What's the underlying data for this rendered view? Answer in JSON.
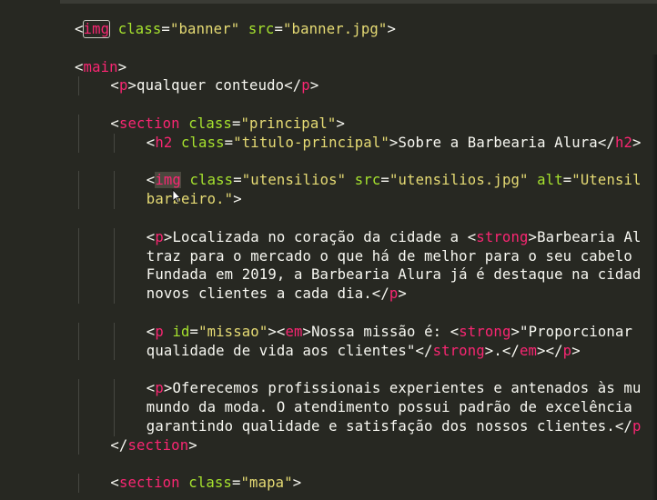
{
  "editor": {
    "theme": "monokai",
    "colors": {
      "background": "#272822",
      "tag": "#f92672",
      "attribute": "#a6e22e",
      "string": "#e6db74",
      "text": "#f8f8f2"
    },
    "lines": [
      {
        "indent": 0,
        "tokens": [
          {
            "t": "<",
            "c": "punct"
          },
          {
            "t": "img",
            "c": "tag",
            "boxed": true
          },
          {
            "t": " ",
            "c": "txt"
          },
          {
            "t": "class",
            "c": "attr"
          },
          {
            "t": "=",
            "c": "punct"
          },
          {
            "t": "\"banner\"",
            "c": "str"
          },
          {
            "t": " ",
            "c": "txt"
          },
          {
            "t": "src",
            "c": "attr"
          },
          {
            "t": "=",
            "c": "punct"
          },
          {
            "t": "\"banner.jpg\"",
            "c": "str"
          },
          {
            "t": ">",
            "c": "punct"
          }
        ]
      },
      {
        "indent": 0,
        "tokens": []
      },
      {
        "indent": 0,
        "tokens": [
          {
            "t": "<",
            "c": "punct"
          },
          {
            "t": "main",
            "c": "tag"
          },
          {
            "t": ">",
            "c": "punct"
          }
        ]
      },
      {
        "indent": 1,
        "tokens": [
          {
            "t": "<",
            "c": "punct"
          },
          {
            "t": "p",
            "c": "tag"
          },
          {
            "t": ">",
            "c": "punct"
          },
          {
            "t": "qualquer conteudo",
            "c": "txt"
          },
          {
            "t": "</",
            "c": "punct"
          },
          {
            "t": "p",
            "c": "tag"
          },
          {
            "t": ">",
            "c": "punct"
          }
        ]
      },
      {
        "indent": 0,
        "tokens": []
      },
      {
        "indent": 1,
        "tokens": [
          {
            "t": "<",
            "c": "punct"
          },
          {
            "t": "section",
            "c": "tag"
          },
          {
            "t": " ",
            "c": "txt"
          },
          {
            "t": "class",
            "c": "attr"
          },
          {
            "t": "=",
            "c": "punct"
          },
          {
            "t": "\"principal\"",
            "c": "str"
          },
          {
            "t": ">",
            "c": "punct"
          }
        ]
      },
      {
        "indent": 2,
        "tokens": [
          {
            "t": "<",
            "c": "punct"
          },
          {
            "t": "h2",
            "c": "tag"
          },
          {
            "t": " ",
            "c": "txt"
          },
          {
            "t": "class",
            "c": "attr"
          },
          {
            "t": "=",
            "c": "punct"
          },
          {
            "t": "\"titulo-principal\"",
            "c": "str"
          },
          {
            "t": ">",
            "c": "punct"
          },
          {
            "t": "Sobre a Barbearia Alura",
            "c": "txt"
          },
          {
            "t": "</",
            "c": "punct"
          },
          {
            "t": "h2",
            "c": "tag"
          },
          {
            "t": ">",
            "c": "punct"
          }
        ]
      },
      {
        "indent": 0,
        "tokens": []
      },
      {
        "indent": 2,
        "tokens": [
          {
            "t": "<",
            "c": "punct"
          },
          {
            "t": "img",
            "c": "tag",
            "hl": true
          },
          {
            "t": " ",
            "c": "txt"
          },
          {
            "t": "class",
            "c": "attr"
          },
          {
            "t": "=",
            "c": "punct"
          },
          {
            "t": "\"utensilios\"",
            "c": "str"
          },
          {
            "t": " ",
            "c": "txt"
          },
          {
            "t": "src",
            "c": "attr"
          },
          {
            "t": "=",
            "c": "punct"
          },
          {
            "t": "\"utensilios.jpg\"",
            "c": "str"
          },
          {
            "t": " ",
            "c": "txt"
          },
          {
            "t": "alt",
            "c": "attr"
          },
          {
            "t": "=",
            "c": "punct"
          },
          {
            "t": "\"Utensil",
            "c": "str"
          }
        ]
      },
      {
        "indent": 2,
        "tokens": [
          {
            "t": "barbeiro.\"",
            "c": "str"
          },
          {
            "t": ">",
            "c": "punct"
          }
        ]
      },
      {
        "indent": 0,
        "tokens": []
      },
      {
        "indent": 2,
        "tokens": [
          {
            "t": "<",
            "c": "punct"
          },
          {
            "t": "p",
            "c": "tag"
          },
          {
            "t": ">",
            "c": "punct"
          },
          {
            "t": "Localizada no coração da cidade a ",
            "c": "txt"
          },
          {
            "t": "<",
            "c": "punct"
          },
          {
            "t": "strong",
            "c": "tag"
          },
          {
            "t": ">",
            "c": "punct"
          },
          {
            "t": "Barbearia Al",
            "c": "txt"
          }
        ]
      },
      {
        "indent": 2,
        "tokens": [
          {
            "t": "traz para o mercado o que há de melhor para o seu cabelo",
            "c": "txt"
          }
        ]
      },
      {
        "indent": 2,
        "tokens": [
          {
            "t": "Fundada em 2019, a Barbearia Alura já é destaque na cidad",
            "c": "txt"
          }
        ]
      },
      {
        "indent": 2,
        "tokens": [
          {
            "t": "novos clientes a cada dia.",
            "c": "txt"
          },
          {
            "t": "</",
            "c": "punct"
          },
          {
            "t": "p",
            "c": "tag"
          },
          {
            "t": ">",
            "c": "punct"
          }
        ]
      },
      {
        "indent": 0,
        "tokens": []
      },
      {
        "indent": 2,
        "tokens": [
          {
            "t": "<",
            "c": "punct"
          },
          {
            "t": "p",
            "c": "tag"
          },
          {
            "t": " ",
            "c": "txt"
          },
          {
            "t": "id",
            "c": "attr"
          },
          {
            "t": "=",
            "c": "punct"
          },
          {
            "t": "\"missao\"",
            "c": "str"
          },
          {
            "t": ">",
            "c": "punct"
          },
          {
            "t": "<",
            "c": "punct"
          },
          {
            "t": "em",
            "c": "tag"
          },
          {
            "t": ">",
            "c": "punct"
          },
          {
            "t": "Nossa missão é: ",
            "c": "txt"
          },
          {
            "t": "<",
            "c": "punct"
          },
          {
            "t": "strong",
            "c": "tag"
          },
          {
            "t": ">",
            "c": "punct"
          },
          {
            "t": "\"Proporcionar",
            "c": "txt"
          }
        ]
      },
      {
        "indent": 2,
        "tokens": [
          {
            "t": "qualidade de vida aos clientes\"",
            "c": "txt"
          },
          {
            "t": "</",
            "c": "punct"
          },
          {
            "t": "strong",
            "c": "tag"
          },
          {
            "t": ">",
            "c": "punct"
          },
          {
            "t": ".",
            "c": "txt"
          },
          {
            "t": "</",
            "c": "punct"
          },
          {
            "t": "em",
            "c": "tag"
          },
          {
            "t": ">",
            "c": "punct"
          },
          {
            "t": "</",
            "c": "punct"
          },
          {
            "t": "p",
            "c": "tag"
          },
          {
            "t": ">",
            "c": "punct"
          }
        ]
      },
      {
        "indent": 0,
        "tokens": []
      },
      {
        "indent": 2,
        "tokens": [
          {
            "t": "<",
            "c": "punct"
          },
          {
            "t": "p",
            "c": "tag"
          },
          {
            "t": ">",
            "c": "punct"
          },
          {
            "t": "Oferecemos profissionais experientes e antenados às mu",
            "c": "txt"
          }
        ]
      },
      {
        "indent": 2,
        "tokens": [
          {
            "t": "mundo da moda. O atendimento possui padrão de excelência",
            "c": "txt"
          }
        ]
      },
      {
        "indent": 2,
        "tokens": [
          {
            "t": "garantindo qualidade e satisfação dos nossos clientes.",
            "c": "txt"
          },
          {
            "t": "</",
            "c": "punct"
          },
          {
            "t": "p",
            "c": "tag"
          }
        ]
      },
      {
        "indent": 1,
        "tokens": [
          {
            "t": "</",
            "c": "punct"
          },
          {
            "t": "section",
            "c": "tag"
          },
          {
            "t": ">",
            "c": "punct"
          }
        ]
      },
      {
        "indent": 0,
        "tokens": []
      },
      {
        "indent": 1,
        "tokens": [
          {
            "t": "<",
            "c": "punct"
          },
          {
            "t": "section",
            "c": "tag"
          },
          {
            "t": " ",
            "c": "txt"
          },
          {
            "t": "class",
            "c": "attr"
          },
          {
            "t": "=",
            "c": "punct"
          },
          {
            "t": "\"mapa\"",
            "c": "str"
          },
          {
            "t": ">",
            "c": "punct"
          }
        ]
      }
    ]
  }
}
